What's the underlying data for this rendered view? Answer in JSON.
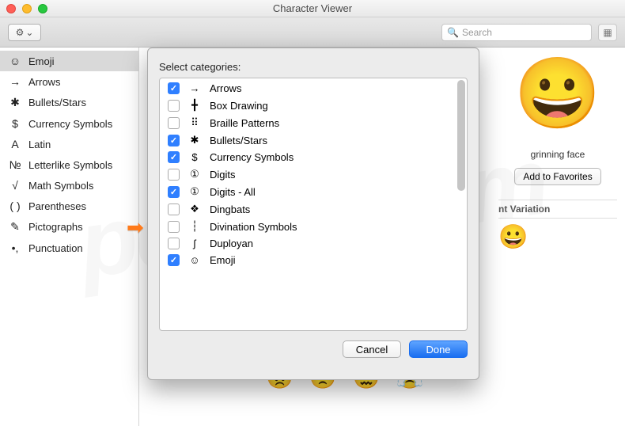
{
  "window": {
    "title": "Character Viewer"
  },
  "search": {
    "placeholder": "Search"
  },
  "sidebar": {
    "items": [
      {
        "icon": "☺",
        "label": "Emoji",
        "selected": true
      },
      {
        "icon": "→",
        "label": "Arrows"
      },
      {
        "icon": "✱",
        "label": "Bullets/Stars"
      },
      {
        "icon": "$",
        "label": "Currency Symbols"
      },
      {
        "icon": "A",
        "label": "Latin"
      },
      {
        "icon": "№",
        "label": "Letterlike Symbols"
      },
      {
        "icon": "√",
        "label": "Math Symbols"
      },
      {
        "icon": "( )",
        "label": "Parentheses"
      },
      {
        "icon": "✎",
        "label": "Pictographs"
      },
      {
        "icon": "•,",
        "label": "Punctuation"
      }
    ]
  },
  "sheet": {
    "heading": "Select categories:",
    "items": [
      {
        "checked": true,
        "icon": "→",
        "label": "Arrows"
      },
      {
        "checked": false,
        "icon": "╋",
        "label": "Box Drawing"
      },
      {
        "checked": false,
        "icon": "⠿",
        "label": "Braille Patterns"
      },
      {
        "checked": true,
        "icon": "✱",
        "label": "Bullets/Stars"
      },
      {
        "checked": true,
        "icon": "$",
        "label": "Currency Symbols"
      },
      {
        "checked": false,
        "icon": "①",
        "label": "Digits"
      },
      {
        "checked": true,
        "icon": "①",
        "label": "Digits - All"
      },
      {
        "checked": false,
        "icon": "❖",
        "label": "Dingbats"
      },
      {
        "checked": false,
        "icon": "┆",
        "label": "Divination Symbols"
      },
      {
        "checked": false,
        "icon": "ʃ",
        "label": "Duployan"
      },
      {
        "checked": true,
        "icon": "☺",
        "label": "Emoji"
      }
    ],
    "cancel": "Cancel",
    "done": "Done"
  },
  "preview": {
    "emoji": "😀",
    "name": "grinning face",
    "favorites": "Add to Favorites",
    "variation_label": "nt Variation",
    "variation_emoji": "😀"
  },
  "grid_row": [
    "😠",
    "😣",
    "😖",
    "😤"
  ],
  "watermark": "pcrisk.com"
}
